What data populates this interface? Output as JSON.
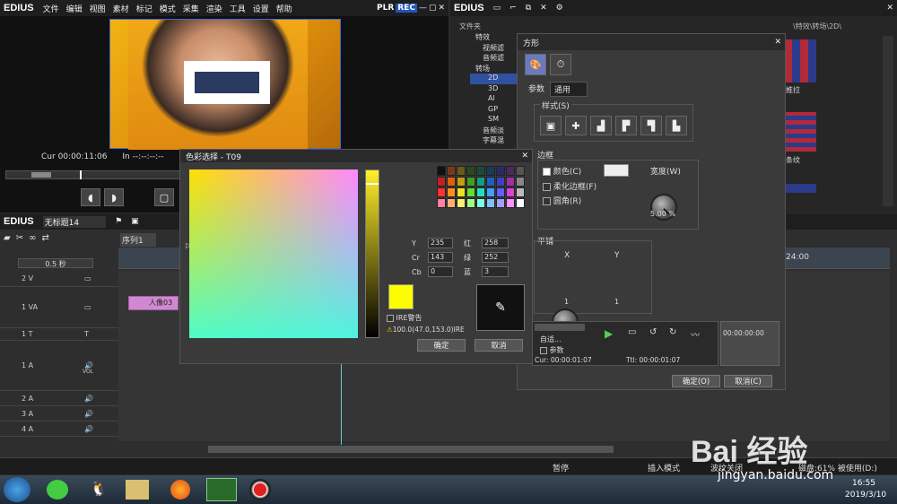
{
  "player": {
    "logo": "EDIUS",
    "menu": [
      "文件",
      "编辑",
      "视图",
      "素材",
      "标记",
      "模式",
      "采集",
      "渲染",
      "工具",
      "设置",
      "帮助"
    ],
    "plr": "PLR",
    "rec": "REC",
    "cur_label": "Cur",
    "cur_value": "00:00:11:06",
    "in_label": "In",
    "in_value": "--:--:--:--"
  },
  "effects": {
    "logo": "EDIUS",
    "folder_header": "文件夹",
    "path": "\\特效\\转场\\2D\\",
    "tree": [
      "特效",
      "视频滤",
      "音频滤",
      "转场",
      "2D",
      "3D",
      "Al",
      "GP",
      "SM",
      "音频淡",
      "字幕混"
    ],
    "thumb_labels": [
      "推拉",
      "条纹"
    ]
  },
  "timeline": {
    "logo": "EDIUS",
    "project": "无标题14",
    "sequence_tab": "序列1",
    "zoom": "0.5 秒",
    "ruler_time": "24:00",
    "tracks": [
      {
        "name": "2 V",
        "icon": "▭"
      },
      {
        "name": "1 VA",
        "icon": "▭"
      },
      {
        "name": "1 T",
        "icon": "T"
      },
      {
        "name": "1 A",
        "icon": "🔊"
      },
      {
        "name": "2 A",
        "icon": "🔊"
      },
      {
        "name": "3 A",
        "icon": "🔊"
      },
      {
        "name": "4 A",
        "icon": "🔊"
      }
    ],
    "vol_label": "VOL",
    "clip_label": "人像03"
  },
  "status_bar": {
    "pause": "暂停",
    "insert": "插入模式",
    "ripple": "波纹关闭",
    "disk": "磁盘:61% 被使用(D:)"
  },
  "shape_dialog": {
    "title": "方形",
    "tabs": [
      "参数",
      "通用"
    ],
    "style_label": "样式(S)",
    "border_label": "边框",
    "color_label": "颜色(C)",
    "soft_border_label": "柔化边框(F)",
    "round_label": "圆角(R)",
    "width_label": "宽度(W)",
    "width_value": "5.00 %",
    "tile_label": "平铺",
    "x_label": "X",
    "y_label": "Y",
    "x_value": "1",
    "y_value": "1",
    "auto_label": "自适...",
    "param_label": "参数",
    "cur_time": "Cur: 00:00:01:07",
    "ttl_time": "Ttl: 00:00:01:07",
    "preview_time": "00:00:00:00",
    "ok": "确定(O)",
    "cancel": "取消(C)",
    "border_color": "#eeeeee"
  },
  "color_dialog": {
    "title": "色彩选择 - T09",
    "y_label": "Y",
    "y_value": "235",
    "cr_label": "Cr",
    "cr_value": "143",
    "cb_label": "Cb",
    "cb_value": "0",
    "red_label": "红",
    "red_value": "258",
    "green_label": "绿",
    "green_value": "252",
    "blue_label": "蓝",
    "blue_value": "3",
    "ire_label": "IRE警告",
    "ire_value": "100.0(47.0,153.0)IRE",
    "ok": "确定",
    "cancel": "取消",
    "selected_color": "#fcfc03"
  },
  "taskbar": {
    "time": "16:55",
    "date": "2019/3/10",
    "watermark": "Bai 经验",
    "watermark_url": "jingyan.baidu.com"
  }
}
